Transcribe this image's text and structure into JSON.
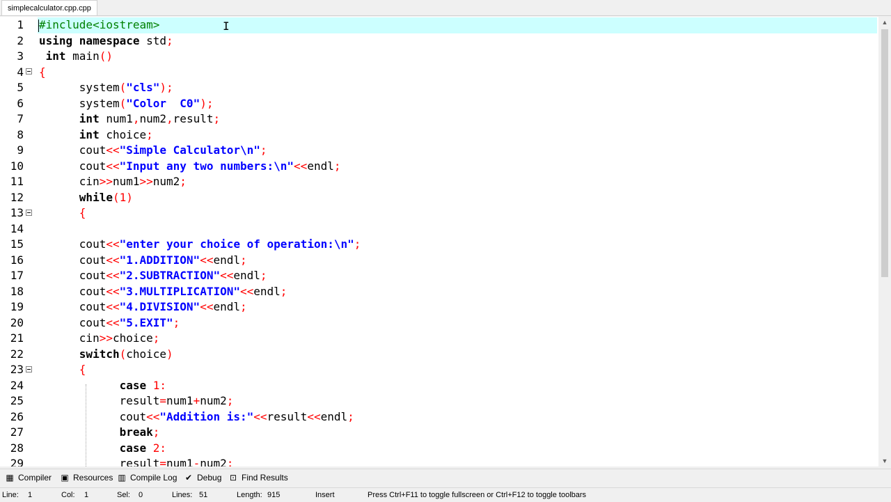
{
  "tab": {
    "filename": "simplecalculator.cpp.cpp"
  },
  "editor": {
    "lines": [
      [
        [
          "pp",
          "#include<iostream>"
        ]
      ],
      [
        [
          "kw",
          "using namespace "
        ],
        [
          "pl",
          "std"
        ],
        [
          "op",
          ";"
        ]
      ],
      [
        [
          "pl",
          " "
        ],
        [
          "kw",
          "int "
        ],
        [
          "pl",
          "main"
        ],
        [
          "op",
          "()"
        ]
      ],
      [
        [
          "br",
          "{"
        ]
      ],
      [
        [
          "pl",
          "      system"
        ],
        [
          "op",
          "("
        ],
        [
          "str",
          "\"cls\""
        ],
        [
          "op",
          ");"
        ]
      ],
      [
        [
          "pl",
          "      system"
        ],
        [
          "op",
          "("
        ],
        [
          "str",
          "\"Color  C0\""
        ],
        [
          "op",
          ");"
        ]
      ],
      [
        [
          "pl",
          "      "
        ],
        [
          "kw",
          "int "
        ],
        [
          "pl",
          "num1"
        ],
        [
          "op",
          ","
        ],
        [
          "pl",
          "num2"
        ],
        [
          "op",
          ","
        ],
        [
          "pl",
          "result"
        ],
        [
          "op",
          ";"
        ]
      ],
      [
        [
          "pl",
          "      "
        ],
        [
          "kw",
          "int "
        ],
        [
          "pl",
          "choice"
        ],
        [
          "op",
          ";"
        ]
      ],
      [
        [
          "pl",
          "      cout"
        ],
        [
          "op",
          "<<"
        ],
        [
          "str",
          "\"Simple Calculator\\n\""
        ],
        [
          "op",
          ";"
        ]
      ],
      [
        [
          "pl",
          "      cout"
        ],
        [
          "op",
          "<<"
        ],
        [
          "str",
          "\"Input any two numbers:\\n\""
        ],
        [
          "op",
          "<<"
        ],
        [
          "pl",
          "endl"
        ],
        [
          "op",
          ";"
        ]
      ],
      [
        [
          "pl",
          "      cin"
        ],
        [
          "op",
          ">>"
        ],
        [
          "pl",
          "num1"
        ],
        [
          "op",
          ">>"
        ],
        [
          "pl",
          "num2"
        ],
        [
          "op",
          ";"
        ]
      ],
      [
        [
          "pl",
          "      "
        ],
        [
          "kw",
          "while"
        ],
        [
          "op",
          "("
        ],
        [
          "num",
          "1"
        ],
        [
          "op",
          ")"
        ]
      ],
      [
        [
          "pl",
          "      "
        ],
        [
          "br",
          "{"
        ]
      ],
      [
        [
          "pl",
          ""
        ]
      ],
      [
        [
          "pl",
          "      cout"
        ],
        [
          "op",
          "<<"
        ],
        [
          "str",
          "\"enter your choice of operation:\\n\""
        ],
        [
          "op",
          ";"
        ]
      ],
      [
        [
          "pl",
          "      cout"
        ],
        [
          "op",
          "<<"
        ],
        [
          "str",
          "\"1.ADDITION\""
        ],
        [
          "op",
          "<<"
        ],
        [
          "pl",
          "endl"
        ],
        [
          "op",
          ";"
        ]
      ],
      [
        [
          "pl",
          "      cout"
        ],
        [
          "op",
          "<<"
        ],
        [
          "str",
          "\"2.SUBTRACTION\""
        ],
        [
          "op",
          "<<"
        ],
        [
          "pl",
          "endl"
        ],
        [
          "op",
          ";"
        ]
      ],
      [
        [
          "pl",
          "      cout"
        ],
        [
          "op",
          "<<"
        ],
        [
          "str",
          "\"3.MULTIPLICATION\""
        ],
        [
          "op",
          "<<"
        ],
        [
          "pl",
          "endl"
        ],
        [
          "op",
          ";"
        ]
      ],
      [
        [
          "pl",
          "      cout"
        ],
        [
          "op",
          "<<"
        ],
        [
          "str",
          "\"4.DIVISION\""
        ],
        [
          "op",
          "<<"
        ],
        [
          "pl",
          "endl"
        ],
        [
          "op",
          ";"
        ]
      ],
      [
        [
          "pl",
          "      cout"
        ],
        [
          "op",
          "<<"
        ],
        [
          "str",
          "\"5.EXIT\""
        ],
        [
          "op",
          ";"
        ]
      ],
      [
        [
          "pl",
          "      cin"
        ],
        [
          "op",
          ">>"
        ],
        [
          "pl",
          "choice"
        ],
        [
          "op",
          ";"
        ]
      ],
      [
        [
          "pl",
          "      "
        ],
        [
          "kw",
          "switch"
        ],
        [
          "op",
          "("
        ],
        [
          "pl",
          "choice"
        ],
        [
          "op",
          ")"
        ]
      ],
      [
        [
          "pl",
          "      "
        ],
        [
          "br",
          "{"
        ]
      ],
      [
        [
          "pl",
          "            "
        ],
        [
          "kw",
          "case "
        ],
        [
          "num",
          "1"
        ],
        [
          "op",
          ":"
        ]
      ],
      [
        [
          "pl",
          "            result"
        ],
        [
          "op",
          "="
        ],
        [
          "pl",
          "num1"
        ],
        [
          "op",
          "+"
        ],
        [
          "pl",
          "num2"
        ],
        [
          "op",
          ";"
        ]
      ],
      [
        [
          "pl",
          "            cout"
        ],
        [
          "op",
          "<<"
        ],
        [
          "str",
          "\"Addition is:\""
        ],
        [
          "op",
          "<<"
        ],
        [
          "pl",
          "result"
        ],
        [
          "op",
          "<<"
        ],
        [
          "pl",
          "endl"
        ],
        [
          "op",
          ";"
        ]
      ],
      [
        [
          "pl",
          "            "
        ],
        [
          "kw",
          "break"
        ],
        [
          "op",
          ";"
        ]
      ],
      [
        [
          "pl",
          "            "
        ],
        [
          "kw",
          "case "
        ],
        [
          "num",
          "2"
        ],
        [
          "op",
          ":"
        ]
      ],
      [
        [
          "pl",
          "            result"
        ],
        [
          "op",
          "="
        ],
        [
          "pl",
          "num1"
        ],
        [
          "op",
          "-"
        ],
        [
          "pl",
          "num2"
        ],
        [
          "op",
          ";"
        ]
      ]
    ]
  },
  "toolbar": {
    "items": [
      {
        "label": "Compiler",
        "icon": "compiler-icon"
      },
      {
        "label": "Resources",
        "icon": "resources-icon"
      },
      {
        "label": "Compile Log",
        "icon": "compile-log-icon"
      },
      {
        "label": "Debug",
        "icon": "debug-icon"
      },
      {
        "label": "Find Results",
        "icon": "find-results-icon"
      }
    ]
  },
  "status": {
    "line_label": "Line:",
    "line_value": "1",
    "col_label": "Col:",
    "col_value": "1",
    "sel_label": "Sel:",
    "sel_value": "0",
    "lines_label": "Lines:",
    "lines_value": "51",
    "length_label": "Length:",
    "length_value": "915",
    "mode": "Insert",
    "hint": "Press Ctrl+F11 to toggle fullscreen or Ctrl+F12 to toggle toolbars"
  }
}
